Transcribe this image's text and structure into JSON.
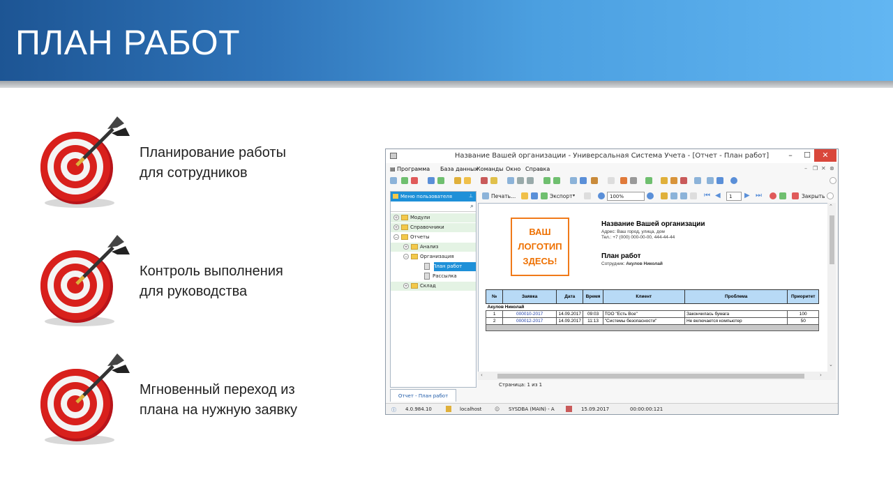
{
  "slide": {
    "title": "ПЛАН РАБОТ",
    "bullets": [
      {
        "line1": "Планирование работы",
        "line2": "для сотрудников"
      },
      {
        "line1": "Контроль выполнения",
        "line2": "для руководства"
      },
      {
        "line1": "Мгновенный переход из",
        "line2": "плана на нужную заявку"
      }
    ]
  },
  "window": {
    "title": "Название Вашей организации - Универсальная Система Учета - [Отчет - План работ]",
    "menu": [
      "Программа",
      "База данных",
      "Команды",
      "Окно",
      "Справка"
    ],
    "left_panel": {
      "header": "Меню пользователя",
      "tree": [
        {
          "label": "Модули",
          "level": 0,
          "type": "folder",
          "exp": "+"
        },
        {
          "label": "Справочники",
          "level": 0,
          "type": "folder",
          "exp": "+"
        },
        {
          "label": "Отчеты",
          "level": 0,
          "type": "folder",
          "exp": "-"
        },
        {
          "label": "Анализ",
          "level": 1,
          "type": "folder",
          "exp": "+"
        },
        {
          "label": "Организация",
          "level": 1,
          "type": "folder",
          "exp": "-"
        },
        {
          "label": "План работ",
          "level": 2,
          "type": "report",
          "selected": true
        },
        {
          "label": "Рассылка",
          "level": 2,
          "type": "report"
        },
        {
          "label": "Склад",
          "level": 1,
          "type": "folder",
          "exp": "+"
        }
      ]
    },
    "report_toolbar": {
      "print": "Печать...",
      "export": "Экспорт",
      "zoom": "100%",
      "page": "1",
      "close": "Закрыть"
    },
    "report": {
      "logo_lines": [
        "ВАШ",
        "ЛОГОТИП",
        "ЗДЕСЬ!"
      ],
      "org_name": "Название Вашей организации",
      "address": "Адрес: Ваш город, улица, дом",
      "phone": "Тел.: +7 (000) 000-00-00, 444-44-44",
      "title": "План работ",
      "employee_label": "Сотрудник:",
      "employee": "Акулов Николай",
      "columns": [
        "№",
        "Заявка",
        "Дата",
        "Время",
        "Клиент",
        "Проблема",
        "Приоритет"
      ],
      "group": "Акулов Николай",
      "rows": [
        [
          "1",
          "000010-2017",
          "14.09.2017",
          "09:03",
          "ТОО \"Есть Все\"",
          "Закончилась бумага",
          "100"
        ],
        [
          "2",
          "000012-2017",
          "14.09.2017",
          "11:13",
          "\"Системы безопасности\"",
          "Не включается компьютер",
          "50"
        ]
      ]
    },
    "page_info": "Страница: 1 из 1",
    "tab_label": "Отчет - План работ",
    "status": {
      "version": "4.0.984.10",
      "server": "localhost",
      "user": "SYSDBA (MAIN) - A",
      "date": "15.09.2017",
      "timer": "00:00:00:121"
    }
  },
  "colors": {
    "header_dark": "#1d5594",
    "header_light": "#62b6f2",
    "accent_blue": "#1e90d8",
    "logo_orange": "#ee7000",
    "target_red": "#d8201c"
  }
}
